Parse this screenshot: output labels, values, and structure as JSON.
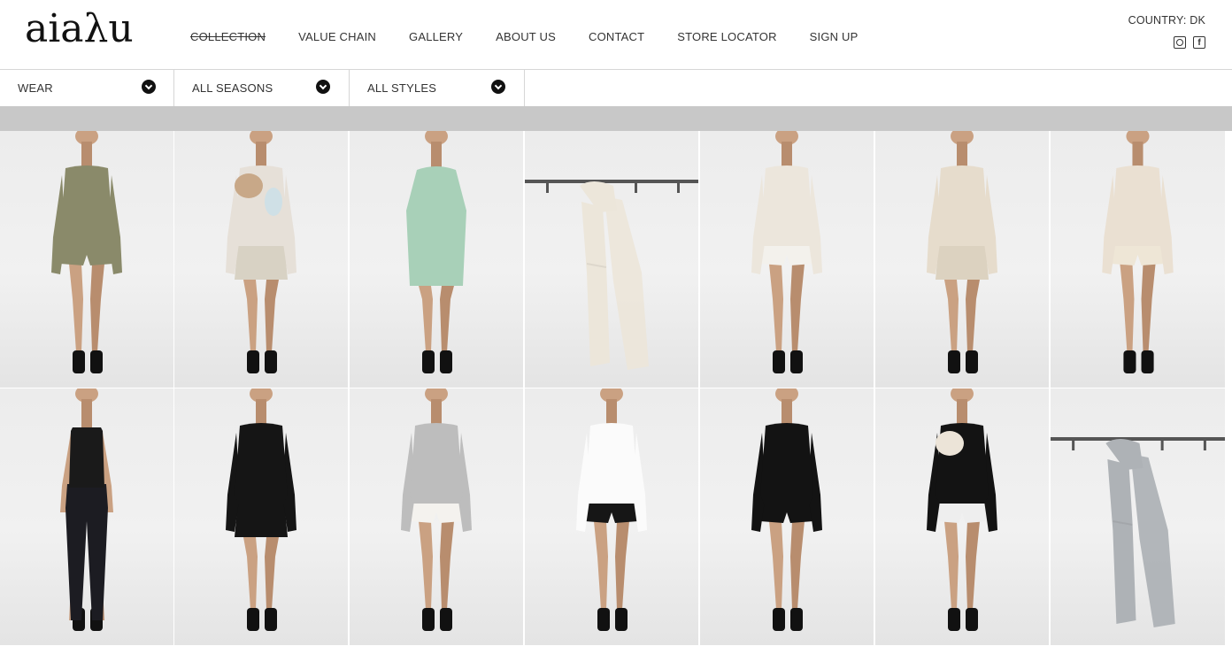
{
  "brand": {
    "logo_text": "aiaλu"
  },
  "nav": [
    {
      "label": "COLLECTION",
      "active": true
    },
    {
      "label": "VALUE CHAIN"
    },
    {
      "label": "GALLERY"
    },
    {
      "label": "ABOUT US"
    },
    {
      "label": "CONTACT"
    },
    {
      "label": "STORE LOCATOR"
    },
    {
      "label": "SIGN UP"
    }
  ],
  "country": {
    "label": "COUNTRY: DK"
  },
  "social": [
    {
      "icon": "instagram-icon"
    },
    {
      "icon": "facebook-icon",
      "glyph": "f"
    }
  ],
  "filters": [
    {
      "label": "WEAR",
      "icon": "chevron-down-icon"
    },
    {
      "label": "ALL SEASONS",
      "icon": "chevron-down-icon"
    },
    {
      "label": "ALL STYLES",
      "icon": "chevron-down-icon"
    }
  ],
  "products": [
    {
      "kind": "model",
      "top": "#8a8a6a",
      "bottom": "#8a8a6a",
      "bottom_type": "shorts"
    },
    {
      "kind": "model",
      "top": "#e6e0d8",
      "bottom": "#d8d2c4",
      "bottom_type": "skirt",
      "accent": "#c8a888",
      "accent2": "#cfe0e6"
    },
    {
      "kind": "model",
      "top": "#a8d0b8",
      "bottom": "#a8d0b8",
      "bottom_type": "dress"
    },
    {
      "kind": "scarf",
      "color": "#ece6da",
      "rail": true
    },
    {
      "kind": "model",
      "top": "#ece6dc",
      "bottom": "#f3f1ec",
      "bottom_type": "shorts"
    },
    {
      "kind": "model",
      "top": "#e6dccc",
      "bottom": "#dcd2c0",
      "bottom_type": "skirt"
    },
    {
      "kind": "model",
      "top": "#eae0d2",
      "bottom": "#eee6d6",
      "bottom_type": "shorts"
    },
    {
      "kind": "model",
      "top": "#1a1a1a",
      "bottom": "#1c1c22",
      "bottom_type": "pants",
      "strappy": true
    },
    {
      "kind": "model",
      "top": "#151515",
      "bottom": "#151515",
      "bottom_type": "skirt"
    },
    {
      "kind": "model",
      "top": "#bdbdbd",
      "bottom": "#f4f2ee",
      "bottom_type": "shorts"
    },
    {
      "kind": "model",
      "top": "#fbfbfb",
      "bottom": "#161616",
      "bottom_type": "shorts"
    },
    {
      "kind": "model",
      "top": "#131313",
      "bottom": "#131313",
      "bottom_type": "shorts"
    },
    {
      "kind": "model",
      "top": "#131313",
      "bottom": "#eeeeee",
      "bottom_type": "shorts",
      "accent": "#ece4d8"
    },
    {
      "kind": "scarf",
      "color": "#aeb2b6",
      "rail": true
    }
  ]
}
